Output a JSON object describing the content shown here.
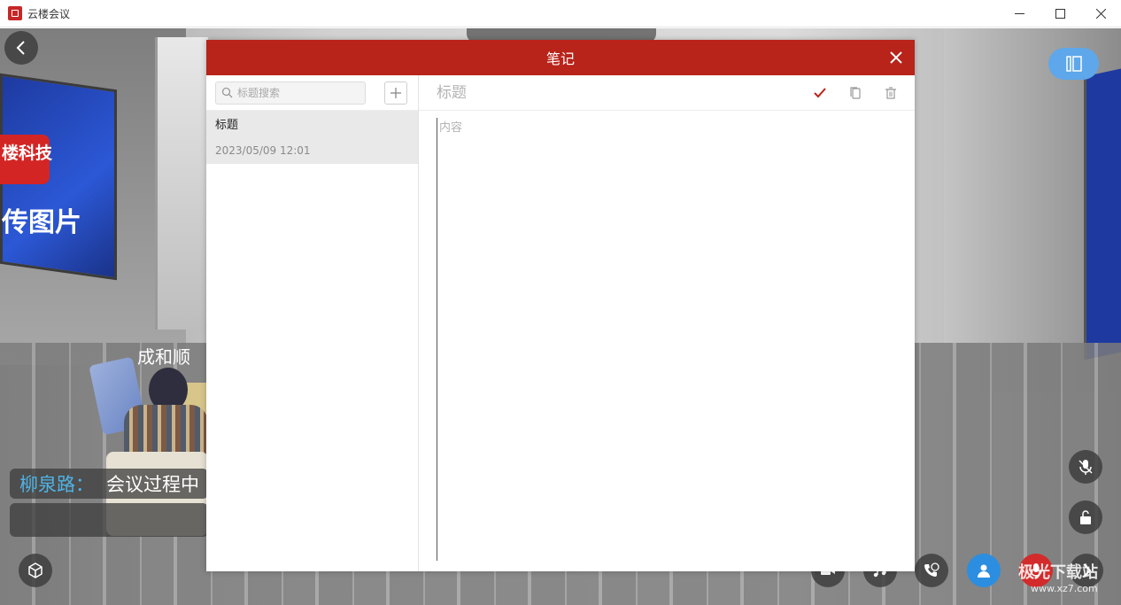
{
  "window": {
    "title": "云楼会议",
    "controls": [
      "minimize-icon",
      "maximize-icon",
      "close-icon"
    ]
  },
  "scene": {
    "screen_logo_text": "楼科技",
    "screen_text": "传图片",
    "avatar_name": "成和顺",
    "chat": {
      "sender": "柳泉路：",
      "message": "会议过程中"
    },
    "watermark": "极光下载站",
    "watermark_url": "www.xz7.com"
  },
  "notes": {
    "title": "笔记",
    "search_placeholder": "标题搜索",
    "items": [
      {
        "title": "标题",
        "date": "2023/05/09 12:01"
      }
    ],
    "editor": {
      "title_placeholder": "标题",
      "content_placeholder": "内容"
    }
  },
  "colors": {
    "header": "#b8231a",
    "accent_blue": "#5ea7ea",
    "chat_sender": "#4fb3e6",
    "mic_red": "#d32b2b"
  }
}
